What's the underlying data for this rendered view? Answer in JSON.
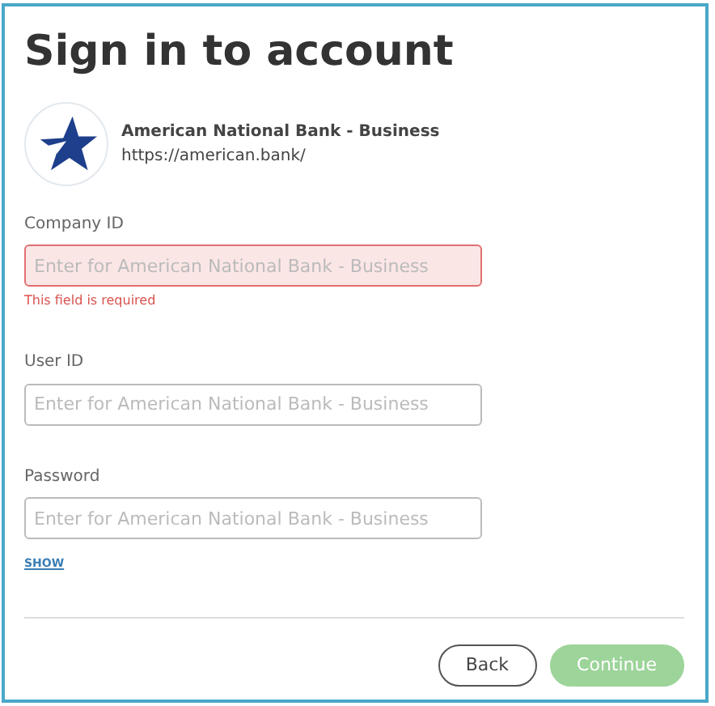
{
  "title": "Sign in to account",
  "bank": {
    "name": "American National Bank - Business",
    "url": "https://american.bank/"
  },
  "fields": [
    {
      "label": "Company ID",
      "placeholder": "Enter for American National Bank - Business",
      "invalid": true,
      "error": "This field is required"
    },
    {
      "label": "User ID",
      "placeholder": "Enter for American National Bank - Business",
      "invalid": false
    },
    {
      "label": "Password",
      "placeholder": "Enter for American National Bank - Business",
      "invalid": false,
      "toggle": "SHOW"
    }
  ],
  "buttons": [
    {
      "label": "Back",
      "kind": "outline",
      "disabled": false
    },
    {
      "label": "Continue",
      "kind": "primary",
      "disabled": true
    }
  ]
}
